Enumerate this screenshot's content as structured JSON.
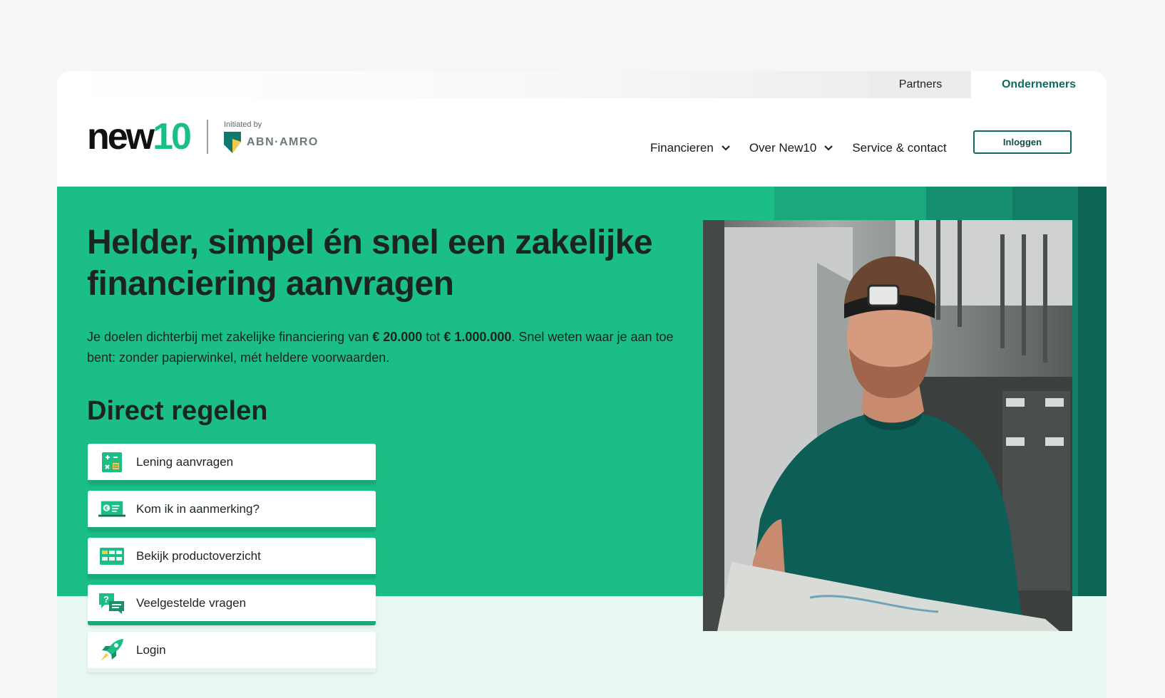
{
  "audience": {
    "partners": "Partners",
    "ondernemers": "Ondernemers"
  },
  "logo": {
    "word": "new",
    "number": "10",
    "initiated_by": "Initiated by",
    "bank": "ABN·AMRO"
  },
  "nav": {
    "items": [
      {
        "label": "Financieren",
        "dropdown": true
      },
      {
        "label": "Over New10",
        "dropdown": true
      },
      {
        "label": "Service & contact",
        "dropdown": false
      }
    ],
    "login_label": "Inloggen"
  },
  "hero": {
    "title": "Helder, simpel én snel een zakelijke financiering aanvragen",
    "text_part1": "Je doelen dichterbij met zakelijke financiering van ",
    "amount_min": "€ 20.000",
    "text_part2": " tot ",
    "amount_max": "€ 1.000.000",
    "text_part3": ". Snel weten waar je aan toe bent: zonder papierwinkel, mét heldere voorwaarden.",
    "direct_title": "Direct regelen"
  },
  "quick_links": [
    {
      "label": "Lening aanvragen",
      "icon": "calculator-icon"
    },
    {
      "label": "Kom ik in aanmerking?",
      "icon": "laptop-check-icon"
    },
    {
      "label": "Bekijk productoverzicht",
      "icon": "product-grid-icon"
    },
    {
      "label": "Veelgestelde vragen",
      "icon": "chat-question-icon"
    },
    {
      "label": "Login",
      "icon": "rocket-icon"
    }
  ],
  "colors": {
    "brand_green": "#1bbf85",
    "dark_teal": "#0f6b5f",
    "light_mint": "#e9f7f1",
    "accent_yellow": "#f5c84c"
  }
}
